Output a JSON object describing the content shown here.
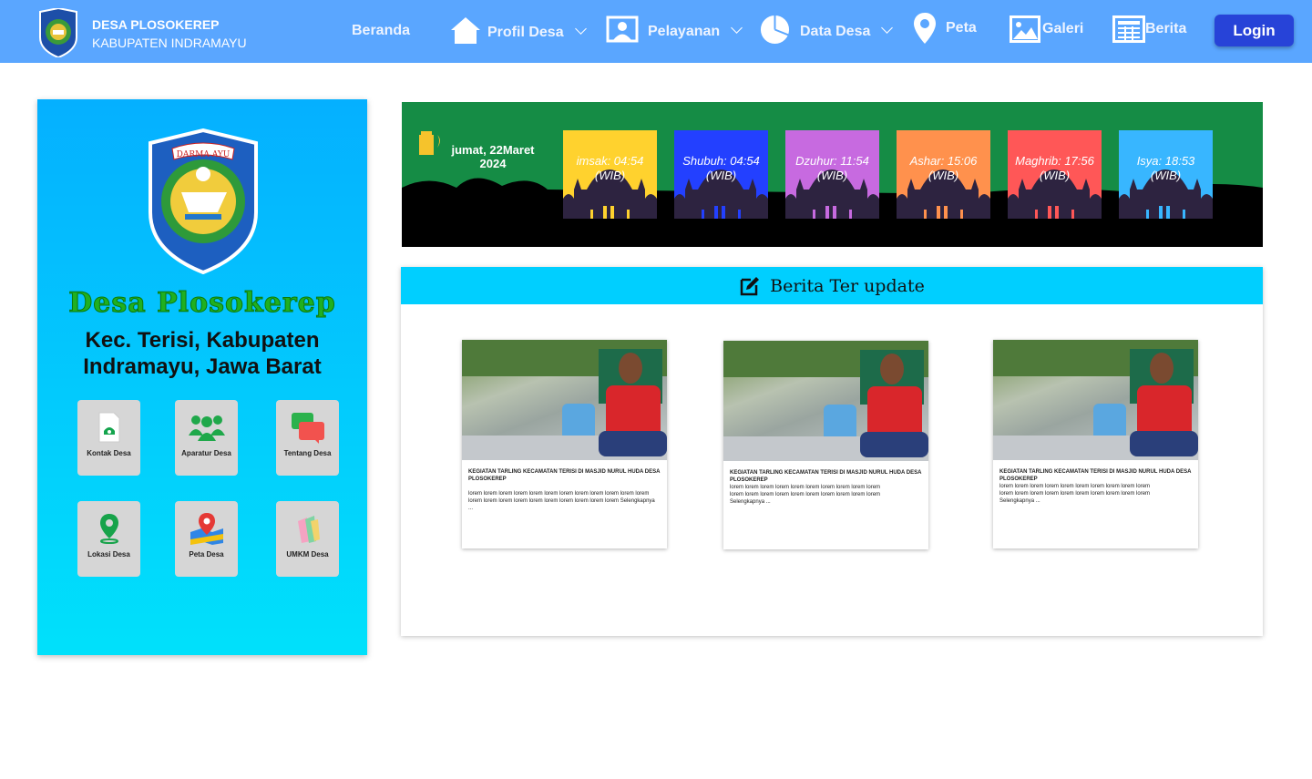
{
  "header": {
    "brand_line1": "DESA PLOSOKEREP",
    "brand_line2": "KABUPATEN INDRAMAYU",
    "nav": [
      {
        "label": "Beranda",
        "icon": ""
      },
      {
        "label": "Profil Desa",
        "icon": "home-icon",
        "dropdown": true
      },
      {
        "label": "Pelayanan",
        "icon": "user-portrait-icon",
        "dropdown": true
      },
      {
        "label": "Data Desa",
        "icon": "pie-chart-icon",
        "dropdown": true
      },
      {
        "label": "Peta",
        "icon": "map-pin-icon"
      },
      {
        "label": "Galeri",
        "icon": "image-icon"
      },
      {
        "label": "Berita",
        "icon": "newspaper-icon"
      }
    ],
    "login": "Login",
    "color": "#5aa6ff"
  },
  "sidebar": {
    "emblem_text": "DARMA AYU",
    "title": "Desa Plosokerep",
    "subtitle": "Kec. Terisi, Kabupaten Indramayu, Jawa Barat",
    "tiles": [
      {
        "label": "Kontak Desa",
        "icon": "phone-icon"
      },
      {
        "label": "Aparatur Desa",
        "icon": "people-icon"
      },
      {
        "label": "Tentang Desa",
        "icon": "chat-icon"
      },
      {
        "label": "Lokasi Desa",
        "icon": "location-icon"
      },
      {
        "label": "Peta Desa",
        "icon": "map-icon"
      },
      {
        "label": "UMKM Desa",
        "icon": "shopping-bag-icon"
      }
    ]
  },
  "prayer": {
    "date_line1": "jumat, 22Maret",
    "date_line2": "2024",
    "times": [
      {
        "label": "imsak: 04:54",
        "zone": "(WIB)",
        "color": "#ffd22e"
      },
      {
        "label": "Shubuh: 04:54",
        "zone": "(WIB)",
        "color": "#2340ff"
      },
      {
        "label": "Dzuhur: 11:54",
        "zone": "(WIB)",
        "color": "#c76ae0"
      },
      {
        "label": "Ashar: 15:06",
        "zone": "(WIB)",
        "color": "#ff914d"
      },
      {
        "label": "Maghrib: 17:56",
        "zone": "(WIB)",
        "color": "#ff5757"
      },
      {
        "label": "Isya: 18:53",
        "zone": "(WIB)",
        "color": "#38b6ff"
      }
    ]
  },
  "news": {
    "heading": "Berita Ter update",
    "cards": [
      {
        "title": "KEGIATAN TARLING KECAMATAN TERISI DI MASJID NURUL HUDA DESA PLOSOKEREP",
        "body": "lorem lorem lorem lorem lorem lorem lorem lorem lorem lorem lorem lorem lorem lorem lorem lorem lorem lorem lorem lorem lorem lorem",
        "more": "Selengkapnya ..."
      },
      {
        "title": "KEGIATAN TARLING KECAMATAN TERISI DI MASJID NURUL HUDA DESA PLOSOKEREP",
        "body": "lorem lorem lorem lorem lorem lorem lorem lorem lorem lorem lorem lorem lorem lorem lorem lorem lorem lorem lorem lorem",
        "more": "Selengkapnya ..."
      },
      {
        "title": "KEGIATAN TARLING KECAMATAN TERISI DI MASJID NURUL HUDA DESA PLOSOKEREP",
        "body": "lorem lorem lorem lorem lorem lorem lorem lorem lorem lorem lorem lorem lorem lorem lorem lorem lorem lorem lorem lorem",
        "more": "Selengkapnya ..."
      }
    ]
  }
}
